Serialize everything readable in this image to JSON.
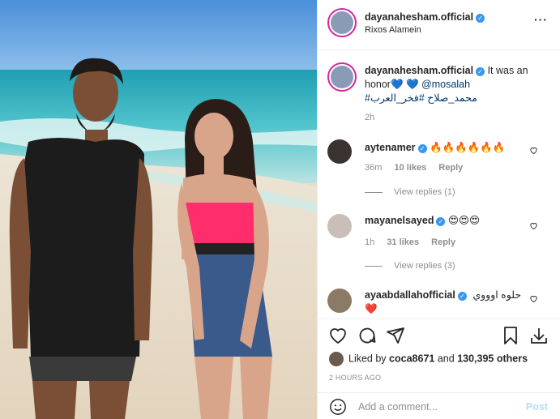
{
  "post": {
    "username": "dayanahesham.official",
    "location": "Rixos Alamein",
    "more_label": "···"
  },
  "caption": {
    "username": "dayanahesham.official",
    "text_before": "It was an honor",
    "hearts": "💙 💙",
    "mention": "@mosalah",
    "hashtags": "#محمد_صلاح #فخر_العرب",
    "age": "2h"
  },
  "comments": [
    {
      "username": "aytenamer",
      "text": "🔥🔥🔥🔥🔥🔥",
      "age": "36m",
      "likes": "10 likes",
      "reply": "Reply",
      "view_replies": "View replies (1)",
      "avatar_color": "#3b3330"
    },
    {
      "username": "mayanelsayed",
      "text": "😍😍😍",
      "age": "1h",
      "likes": "31 likes",
      "reply": "Reply",
      "view_replies": "View replies (3)",
      "avatar_color": "#c9bfb8"
    },
    {
      "username": "ayaabdallahofficial",
      "text": "حلوه اوووي",
      "heart": "❤️",
      "avatar_color": "#8b7a66"
    }
  ],
  "actions": {
    "liked_by_prefix": "Liked by",
    "liked_by_user": "coca8671",
    "liked_by_and": "and",
    "liked_by_count": "130,395 others",
    "timestamp": "2 HOURS AGO"
  },
  "add_comment": {
    "placeholder": "Add a comment...",
    "post_label": "Post"
  },
  "colors": {
    "verified": "#3897f0",
    "link": "#00376b",
    "post_disabled": "#b2dffc",
    "story_ring": "#d6249f"
  }
}
